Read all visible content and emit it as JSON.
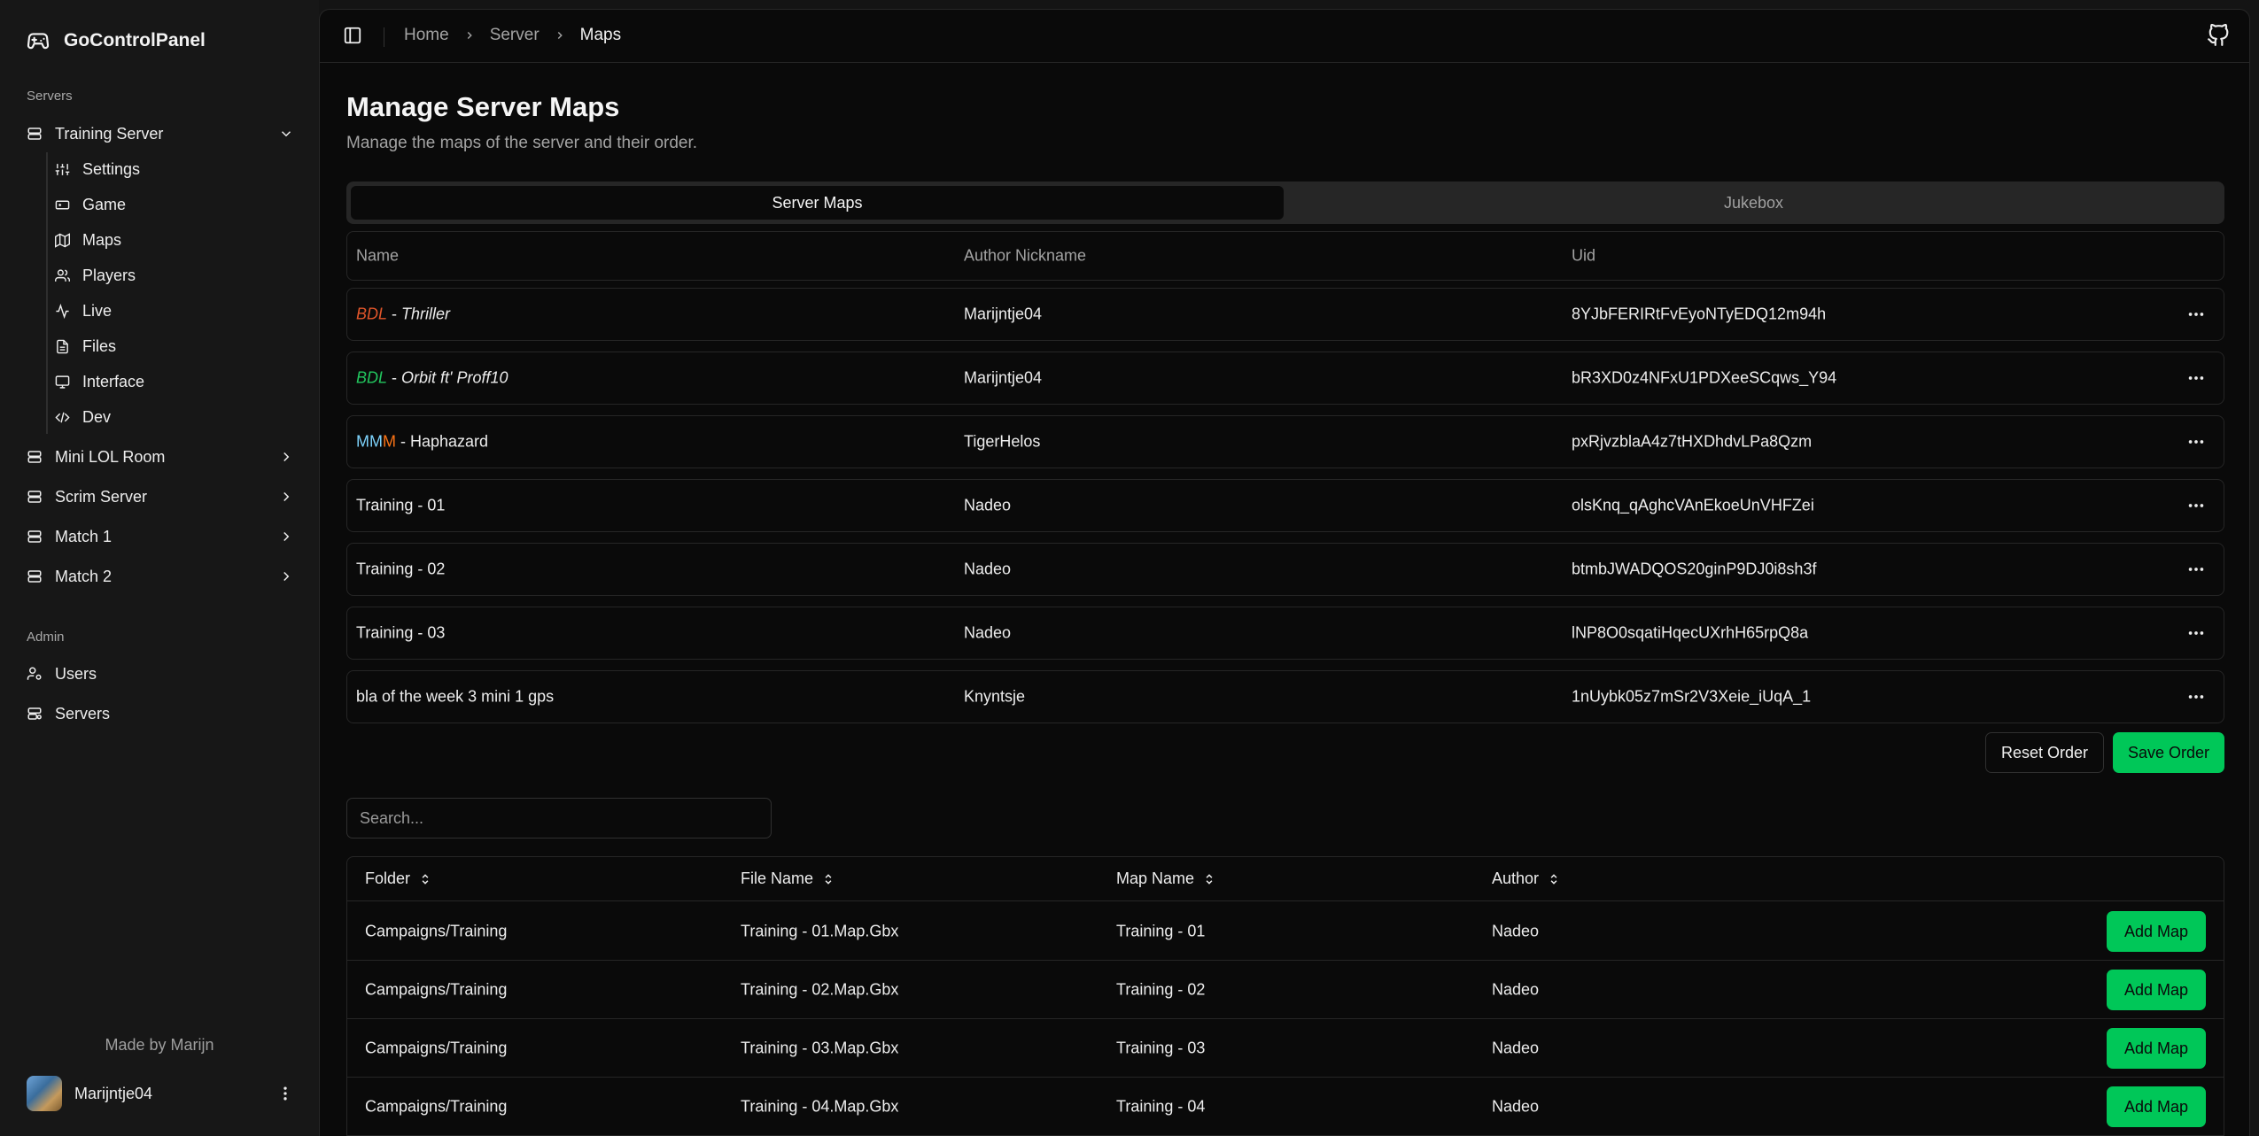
{
  "app": {
    "title": "GoControlPanel"
  },
  "sidebar": {
    "servers_label": "Servers",
    "servers": [
      {
        "label": "Training Server",
        "expanded": true
      },
      {
        "label": "Mini LOL Room"
      },
      {
        "label": "Scrim Server"
      },
      {
        "label": "Match 1"
      },
      {
        "label": "Match 2"
      }
    ],
    "subitems": [
      {
        "label": "Settings",
        "icon": "sliders-icon"
      },
      {
        "label": "Game",
        "icon": "gamepad-icon"
      },
      {
        "label": "Maps",
        "icon": "map-icon"
      },
      {
        "label": "Players",
        "icon": "users-icon"
      },
      {
        "label": "Live",
        "icon": "activity-icon"
      },
      {
        "label": "Files",
        "icon": "file-icon"
      },
      {
        "label": "Interface",
        "icon": "monitor-icon"
      },
      {
        "label": "Dev",
        "icon": "code-icon"
      }
    ],
    "admin_label": "Admin",
    "admin_items": [
      {
        "label": "Users",
        "icon": "user-cog-icon"
      },
      {
        "label": "Servers",
        "icon": "server-icon"
      }
    ],
    "footer": {
      "made_by": "Made by Marijn",
      "username": "Marijntje04"
    }
  },
  "breadcrumb": [
    "Home",
    "Server",
    "Maps"
  ],
  "page": {
    "title": "Manage Server Maps",
    "subtitle": "Manage the maps of the server and their order."
  },
  "tabs": [
    {
      "label": "Server Maps",
      "active": true
    },
    {
      "label": "Jukebox",
      "active": false
    }
  ],
  "server_maps": {
    "columns": [
      "Name",
      "Author Nickname",
      "Uid"
    ],
    "rows": [
      {
        "name_parts": [
          {
            "t": "BDL",
            "c": "#e0552a",
            "i": true
          },
          {
            "t": " - ",
            "c": "#ededed",
            "i": false
          },
          {
            "t": "Thriller",
            "c": "#ededed",
            "i": true
          }
        ],
        "author": "Marijntje04",
        "uid": "8YJbFERIRtFvEyoNTyEDQ12m94h"
      },
      {
        "name_parts": [
          {
            "t": "BDL",
            "c": "#22c55e",
            "i": true
          },
          {
            "t": " - ",
            "c": "#ededed",
            "i": false
          },
          {
            "t": "Orbit ft' Proff10",
            "c": "#ededed",
            "i": true
          }
        ],
        "author": "Marijntje04",
        "uid": "bR3XD0z4NFxU1PDXeeSCqws_Y94"
      },
      {
        "name_parts": [
          {
            "t": "MM",
            "c": "#7dd3fc",
            "i": false
          },
          {
            "t": "M",
            "c": "#f97316",
            "i": false
          },
          {
            "t": " - Haphazard",
            "c": "#ededed",
            "i": false
          }
        ],
        "author": "TigerHelos",
        "uid": "pxRjvzblaA4z7tHXDhdvLPa8Qzm"
      },
      {
        "name_parts": [
          {
            "t": "Training - 01",
            "c": "#ededed",
            "i": false
          }
        ],
        "author": "Nadeo",
        "uid": "olsKnq_qAghcVAnEkoeUnVHFZei"
      },
      {
        "name_parts": [
          {
            "t": "Training - 02",
            "c": "#ededed",
            "i": false
          }
        ],
        "author": "Nadeo",
        "uid": "btmbJWADQOS20ginP9DJ0i8sh3f"
      },
      {
        "name_parts": [
          {
            "t": "Training - 03",
            "c": "#ededed",
            "i": false
          }
        ],
        "author": "Nadeo",
        "uid": "lNP8O0sqatiHqecUXrhH65rpQ8a"
      },
      {
        "name_parts": [
          {
            "t": "bla of the week 3 mini 1 gps",
            "c": "#ededed",
            "i": false
          }
        ],
        "author": "Knyntsje",
        "uid": "1nUybk05z7mSr2V3Xeie_iUqA_1"
      }
    ]
  },
  "actions": {
    "reset": "Reset Order",
    "save": "Save Order"
  },
  "search": {
    "placeholder": "Search...",
    "value": ""
  },
  "files": {
    "columns": [
      "Folder",
      "File Name",
      "Map Name",
      "Author"
    ],
    "add_label": "Add Map",
    "rows": [
      {
        "folder": "Campaigns/Training",
        "file": "Training - 01.Map.Gbx",
        "map": "Training - 01",
        "author": "Nadeo"
      },
      {
        "folder": "Campaigns/Training",
        "file": "Training - 02.Map.Gbx",
        "map": "Training - 02",
        "author": "Nadeo"
      },
      {
        "folder": "Campaigns/Training",
        "file": "Training - 03.Map.Gbx",
        "map": "Training - 03",
        "author": "Nadeo"
      },
      {
        "folder": "Campaigns/Training",
        "file": "Training - 04.Map.Gbx",
        "map": "Training - 04",
        "author": "Nadeo"
      }
    ]
  },
  "colors": {
    "accent": "#00c758",
    "background": "#0a0a0a",
    "sidebar": "#171717",
    "border": "#262626"
  }
}
